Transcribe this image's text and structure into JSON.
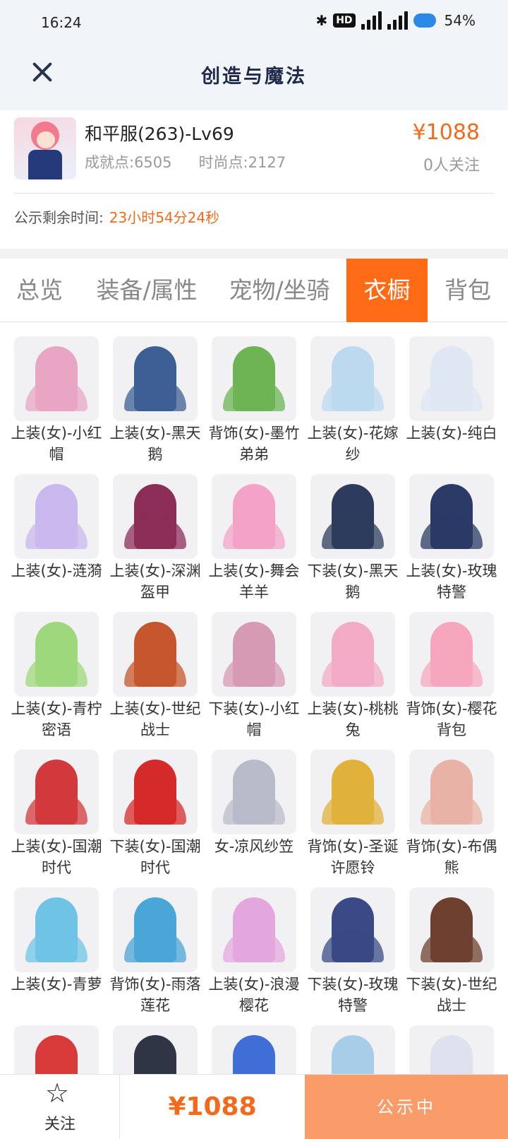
{
  "status_bar": {
    "time": "16:24",
    "battery": "54%"
  },
  "header": {
    "title": "创造与魔法"
  },
  "role": {
    "name": "和平服(263)-Lv69",
    "achievement": "成就点:6505",
    "fashion": "时尚点:2127",
    "price": "¥1088",
    "followers": "0人关注"
  },
  "notice": {
    "label": "公示剩余时间:",
    "time": "23小时54分24秒"
  },
  "tabs": [
    "总览",
    "装备/属性",
    "宠物/坐骑",
    "衣橱",
    "背包"
  ],
  "items": [
    {
      "name": "上装(女)-小红帽",
      "color": "#e8a6c4"
    },
    {
      "name": "上装(女)-黑天鹅",
      "color": "#3e5f93"
    },
    {
      "name": "背饰(女)-墨竹弟弟",
      "color": "#6cb454"
    },
    {
      "name": "上装(女)-花嫁纱",
      "color": "#bcd9ef"
    },
    {
      "name": "上装(女)-纯白",
      "color": "#dfe7f3"
    },
    {
      "name": "上装(女)-涟漪",
      "color": "#c9b8ee"
    },
    {
      "name": "上装(女)-深渊盔甲",
      "color": "#8c2d57"
    },
    {
      "name": "上装(女)-舞会羊羊",
      "color": "#f2a3c7"
    },
    {
      "name": "下装(女)-黑天鹅",
      "color": "#2d3c5e"
    },
    {
      "name": "上装(女)-玫瑰特警",
      "color": "#2b3a66"
    },
    {
      "name": "上装(女)-青柠密语",
      "color": "#9ed87c"
    },
    {
      "name": "上装(女)-世纪战士",
      "color": "#c4552c"
    },
    {
      "name": "下装(女)-小红帽",
      "color": "#d79ab4"
    },
    {
      "name": "上装(女)-桃桃兔",
      "color": "#f2aac5"
    },
    {
      "name": "背饰(女)-樱花背包",
      "color": "#f6a7bd"
    },
    {
      "name": "上装(女)-国潮时代",
      "color": "#d1393c"
    },
    {
      "name": "下装(女)-国潮时代",
      "color": "#d52a2a"
    },
    {
      "name": "女-凉风纱笠",
      "color": "#b9bcc8"
    },
    {
      "name": "背饰(女)-圣诞许愿铃",
      "color": "#e0b23a"
    },
    {
      "name": "背饰(女)-布偶熊",
      "color": "#e8b3a6"
    },
    {
      "name": "上装(女)-青萝",
      "color": "#6fc4e6"
    },
    {
      "name": "背饰(女)-雨落莲花",
      "color": "#4aa6d6"
    },
    {
      "name": "上装(女)-浪漫樱花",
      "color": "#e3a7dd"
    },
    {
      "name": "下装(女)-玫瑰特警",
      "color": "#3a4a86"
    },
    {
      "name": "下装(女)-世纪战士",
      "color": "#6d4030"
    },
    {
      "name": "",
      "color": "#d83a3a"
    },
    {
      "name": "",
      "color": "#2f3545"
    },
    {
      "name": "",
      "color": "#3f6fd6"
    },
    {
      "name": "",
      "color": "#a7cde8"
    },
    {
      "name": "",
      "color": "#dde2ee"
    }
  ],
  "bottom": {
    "follow": "关注",
    "price": "¥1088",
    "status": "公示中"
  }
}
